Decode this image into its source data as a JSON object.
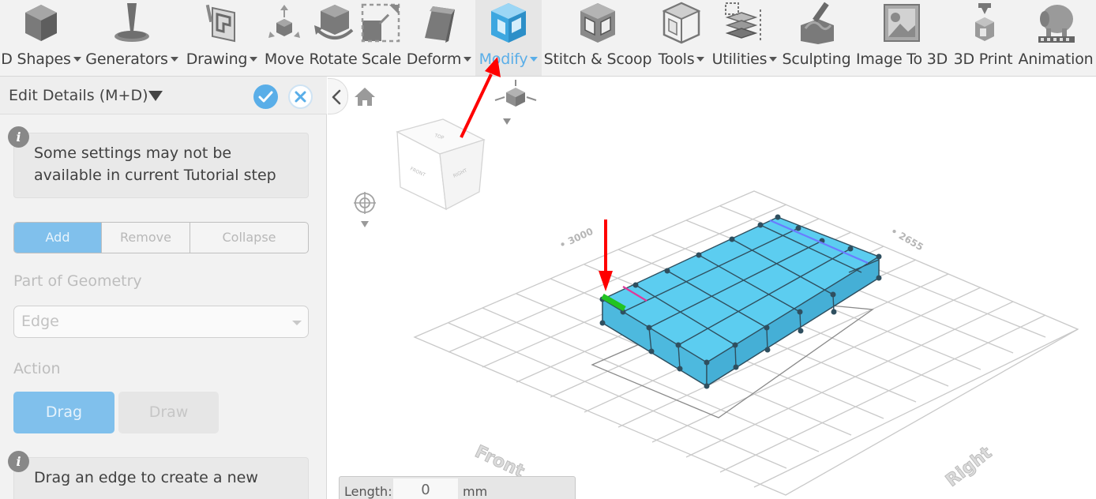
{
  "toolbar": {
    "items": [
      {
        "label": "D Shapes",
        "icon": "cube-icon",
        "dropdown": true
      },
      {
        "label": "Generators",
        "icon": "generator-icon",
        "dropdown": true
      },
      {
        "label": "Drawing",
        "icon": "drawing-icon",
        "dropdown": true
      },
      {
        "label": "Move",
        "icon": "move-icon",
        "dropdown": false
      },
      {
        "label": "Rotate",
        "icon": "rotate-icon",
        "dropdown": false
      },
      {
        "label": "Scale",
        "icon": "scale-icon",
        "dropdown": false
      },
      {
        "label": "Deform",
        "icon": "deform-icon",
        "dropdown": true
      },
      {
        "label": "Modify",
        "icon": "modify-icon",
        "dropdown": true,
        "active": true
      },
      {
        "label": "Stitch & Scoop",
        "icon": "stitch-scoop-icon",
        "dropdown": false
      },
      {
        "label": "Tools",
        "icon": "tools-icon",
        "dropdown": true
      },
      {
        "label": "Utilities",
        "icon": "utilities-icon",
        "dropdown": true
      },
      {
        "label": "Sculpting",
        "icon": "sculpting-icon",
        "dropdown": false
      },
      {
        "label": "Image To 3D",
        "icon": "image-to-3d-icon",
        "dropdown": false
      },
      {
        "label": "3D Print",
        "icon": "3d-print-icon",
        "dropdown": false
      },
      {
        "label": "Animation",
        "icon": "animation-icon",
        "dropdown": false
      }
    ]
  },
  "panel": {
    "title": "Edit Details (M+D)",
    "info_1": "Some settings may not be available in current Tutorial step",
    "mode_tabs": [
      "Add",
      "Remove",
      "Collapse"
    ],
    "active_mode": "Add",
    "part_label": "Part of Geometry",
    "part_value": "Edge",
    "action_label": "Action",
    "actions": [
      "Drag",
      "Draw"
    ],
    "active_action": "Drag",
    "info_2": "Drag an edge to create a new"
  },
  "viewport": {
    "length_label": "Length:",
    "length_value": "0",
    "length_unit": "mm",
    "view_cube": {
      "top": "TOP",
      "front": "FRONT",
      "right": "RIGHT"
    },
    "floor_labels": {
      "front": "Front",
      "right": "Right",
      "left_dims": "• 3000",
      "right_dims": "• 2655"
    }
  },
  "colors": {
    "accent": "#5aaee8",
    "mesh_fill": "#5ccdf0",
    "mesh_edge": "#2f4f5f",
    "selected_edge": "#22c322",
    "annotation_arrow": "#ff0000"
  }
}
